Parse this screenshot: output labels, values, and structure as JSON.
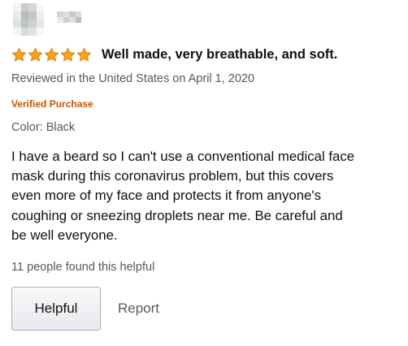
{
  "review": {
    "rating": 5,
    "rating_max": 5,
    "star_color": "#f4a41d",
    "star_border_color": "#e47911",
    "title": "Well made, very breathable, and soft.",
    "date_line": "Reviewed in the United States on April 1, 2020",
    "verified_label": "Verified Purchase",
    "verified_color": "#c45500",
    "variant_line": "Color: Black",
    "body_lines": [
      "I have a beard so I can't use a conventional medical face",
      "mask during this coronavirus problem, but this covers",
      "even more of my face and protects it from anyone's",
      "coughing or sneezing droplets near me. Be careful and",
      "be well everyone."
    ],
    "helpful_count_text": "11 people found this helpful",
    "helpful_button_label": "Helpful",
    "report_label": "Report"
  },
  "icons": {
    "avatar": "avatar-pixelated",
    "reviewer_name": "blurred-name",
    "star": "star-icon"
  }
}
